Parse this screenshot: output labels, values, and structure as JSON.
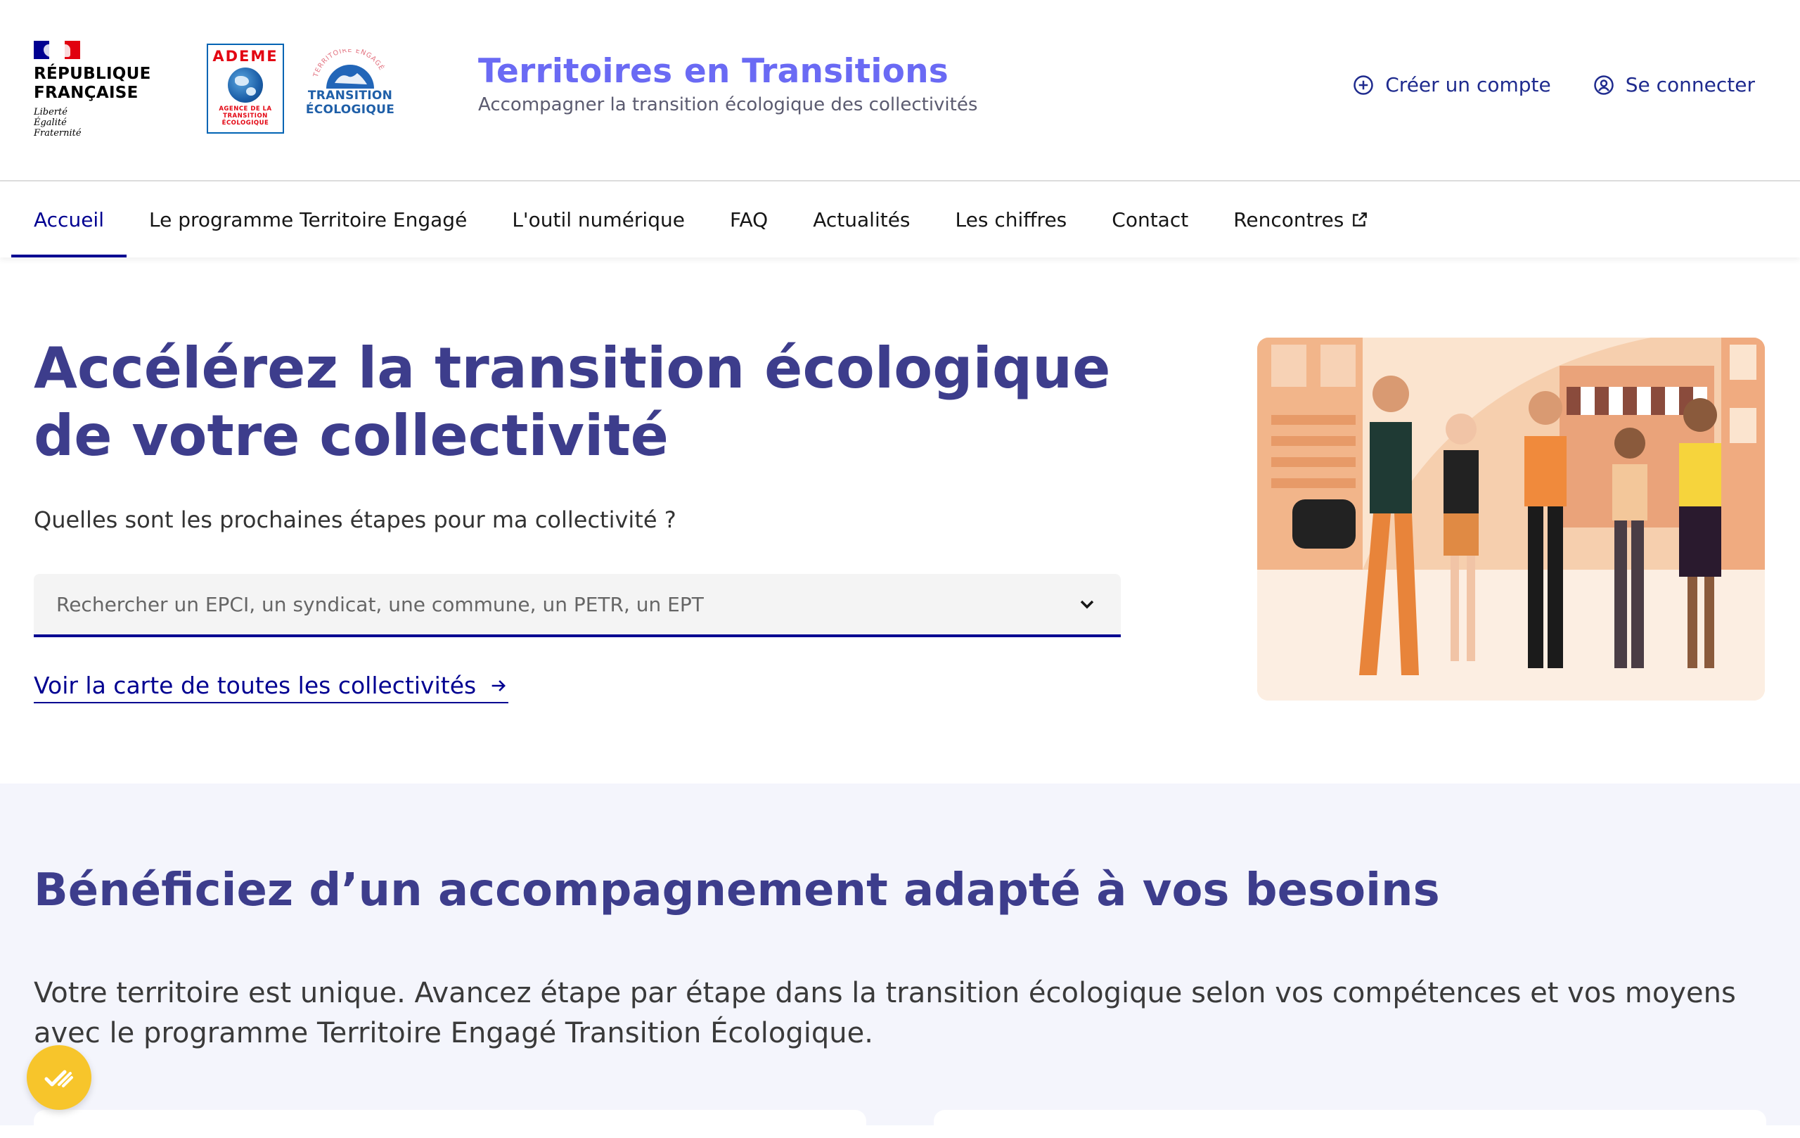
{
  "header": {
    "rf_logo": {
      "name": "RÉPUBLIQUE\nFRANÇAISE",
      "motto": "Liberté\nÉgalité\nFraternité"
    },
    "ademe_logo": {
      "title": "ADEME",
      "subtitle": "AGENCE DE LA\nTRANSITION\nÉCOLOGIQUE"
    },
    "te_logo": {
      "arc_text": "TERRITOIRE ENGAGÉ",
      "text": "TRANSITION\nÉCOLOGIQUE"
    },
    "site_title": "Territoires en Transitions",
    "tagline": "Accompagner la transition écologique des collectivités",
    "create_account": "Créer un compte",
    "login": "Se connecter"
  },
  "nav": {
    "items": [
      {
        "label": "Accueil",
        "active": true
      },
      {
        "label": "Le programme Territoire Engagé"
      },
      {
        "label": "L'outil numérique"
      },
      {
        "label": "FAQ"
      },
      {
        "label": "Actualités"
      },
      {
        "label": "Les chiffres"
      },
      {
        "label": "Contact"
      },
      {
        "label": "Rencontres",
        "external": true
      }
    ]
  },
  "hero": {
    "title": "Accélérez la transition écologique de votre collectivité",
    "question": "Quelles sont les prochaines étapes pour ma collectivité ?",
    "search_placeholder": "Rechercher un EPCI, un syndicat, une commune, un PETR, un EPT",
    "map_link": "Voir la carte de toutes les collectivités"
  },
  "section2": {
    "title": "Bénéficiez d’un accompagnement adapté à vos besoins",
    "text": "Votre territoire est unique. Avancez étape par étape dans la transition écologique selon vos compétences et vos moyens avec le programme Territoire Engagé Transition Écologique."
  },
  "icons": {
    "create_account": "plus-circle-icon",
    "login": "user-circle-icon",
    "external": "external-link-icon",
    "chevron": "chevron-down-icon",
    "arrow": "arrow-right-icon",
    "feedback": "check-feedback-icon"
  },
  "colors": {
    "primary": "#000091",
    "title": "#3d3d8c",
    "brand": "#6a6af4",
    "section_bg": "#f4f5fc",
    "feedback": "#f7c52b"
  }
}
